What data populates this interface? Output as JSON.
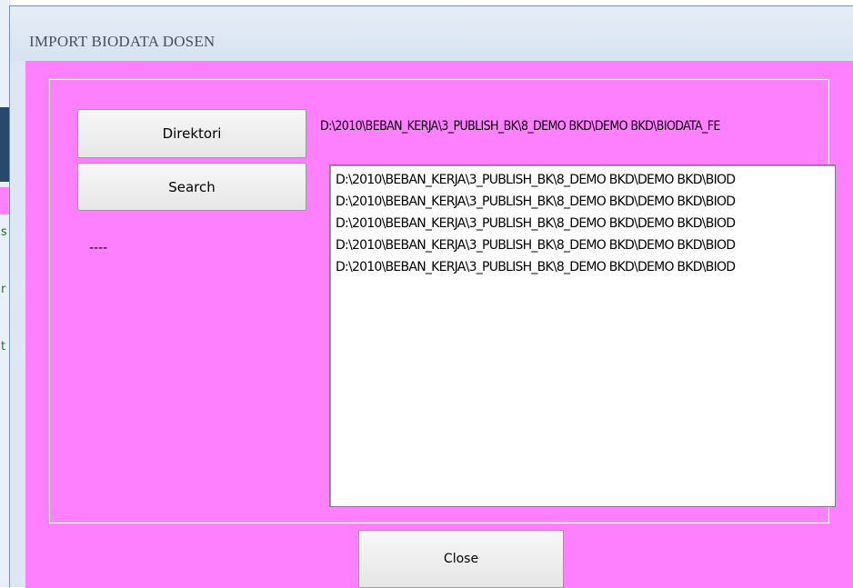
{
  "window": {
    "title": "IMPORT BIODATA DOSEN"
  },
  "buttons": {
    "direktori": "Direktori",
    "search": "Search",
    "close": "Close"
  },
  "path_label": "D:\\2010\\BEBAN_KERJA\\3_PUBLISH_BK\\8_DEMO BKD\\DEMO BKD\\BIODATA_FE",
  "status_label": "----",
  "file_list": [
    "D:\\2010\\BEBAN_KERJA\\3_PUBLISH_BK\\8_DEMO BKD\\DEMO BKD\\BIOD",
    "D:\\2010\\BEBAN_KERJA\\3_PUBLISH_BK\\8_DEMO BKD\\DEMO BKD\\BIOD",
    "D:\\2010\\BEBAN_KERJA\\3_PUBLISH_BK\\8_DEMO BKD\\DEMO BKD\\BIOD",
    "D:\\2010\\BEBAN_KERJA\\3_PUBLISH_BK\\8_DEMO BKD\\DEMO BKD\\BIOD",
    "D:\\2010\\BEBAN_KERJA\\3_PUBLISH_BK\\8_DEMO BKD\\DEMO BKD\\BIOD"
  ],
  "colors": {
    "form_background": "#ff80ff",
    "titlebar": "#dce7f3",
    "list_background": "#ffffff"
  },
  "background_app": {
    "visible_letters": [
      "s",
      "r",
      "t"
    ]
  }
}
